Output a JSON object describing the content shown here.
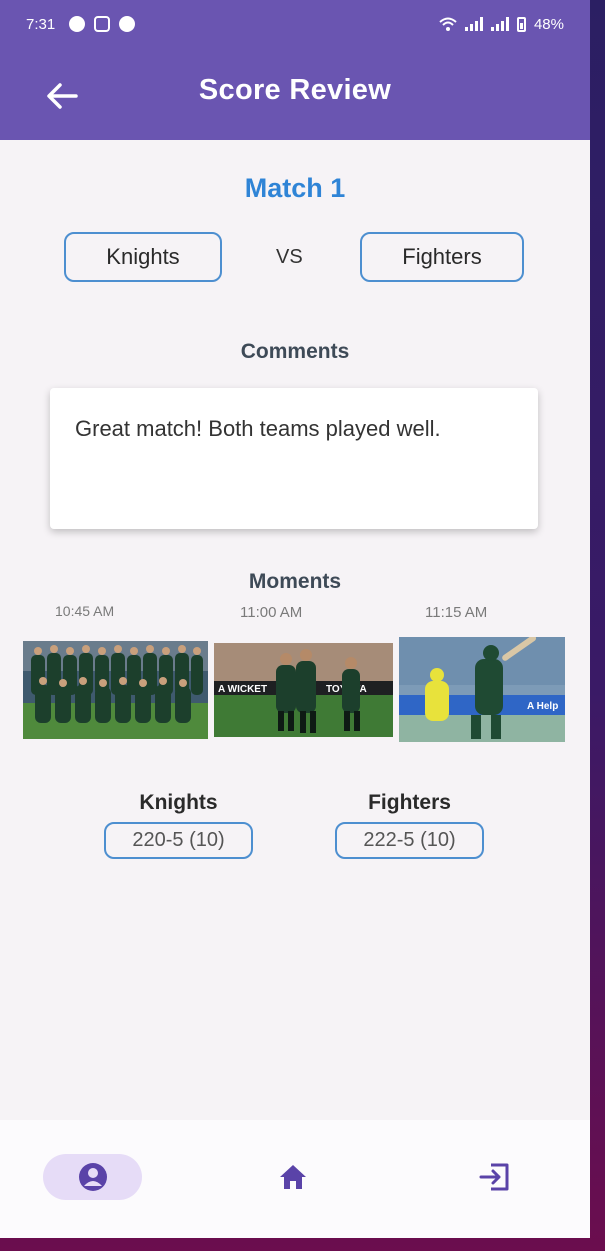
{
  "status_bar": {
    "time": "7:31",
    "battery": "48%"
  },
  "app_bar": {
    "title": "Score Review",
    "back_icon": "arrow-left-icon"
  },
  "match": {
    "title": "Match 1",
    "team_a": "Knights",
    "vs": "VS",
    "team_b": "Fighters"
  },
  "comments": {
    "heading": "Comments",
    "text": "Great match! Both teams played well."
  },
  "moments": {
    "heading": "Moments",
    "items": [
      {
        "time": "10:45 AM",
        "image": "team-photo"
      },
      {
        "time": "11:00 AM",
        "image": "celebration-photo"
      },
      {
        "time": "11:15 AM",
        "image": "batting-photo"
      }
    ]
  },
  "scores": {
    "team_a": {
      "name": "Knights",
      "score": "220-5 (10)"
    },
    "team_b": {
      "name": "Fighters",
      "score": "222-5 (10)"
    }
  },
  "bottom_nav": {
    "items": [
      {
        "icon": "profile-icon",
        "active": true
      },
      {
        "icon": "home-icon",
        "active": false
      },
      {
        "icon": "logout-icon",
        "active": false
      }
    ]
  },
  "colors": {
    "primary": "#6a55b1",
    "accent_blue": "#2f84d6",
    "pill_border": "#4d8fd0",
    "nav_active_bg": "#e6dcf7",
    "nav_icon": "#5a43a8"
  }
}
